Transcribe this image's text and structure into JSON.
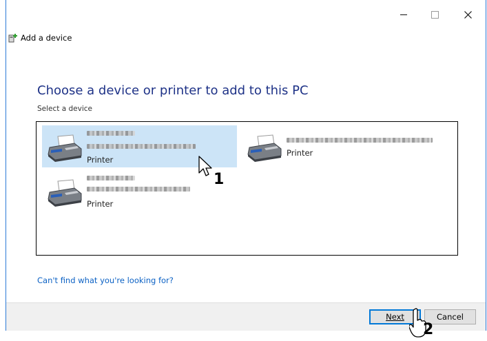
{
  "window": {
    "title": "Add a device",
    "controls": {
      "minimize": "–",
      "maximize": "□",
      "close": "✕"
    }
  },
  "main": {
    "heading": "Choose a device or printer to add to this PC",
    "select_label": "Select a device",
    "devices": [
      {
        "type": "Printer",
        "selected": true,
        "icon": "printer-icon"
      },
      {
        "type": "Printer",
        "selected": false,
        "icon": "printer-icon"
      },
      {
        "type": "Printer",
        "selected": false,
        "icon": "printer-icon"
      }
    ],
    "help_link": "Can't find what you're looking for?"
  },
  "footer": {
    "next_label": "Next",
    "cancel_label": "Cancel"
  },
  "annotations": {
    "step1": "1",
    "step2": "2"
  },
  "colors": {
    "heading": "#1e3287",
    "link": "#0b61c4",
    "selection": "#cce4f7",
    "accent": "#0078d7"
  }
}
